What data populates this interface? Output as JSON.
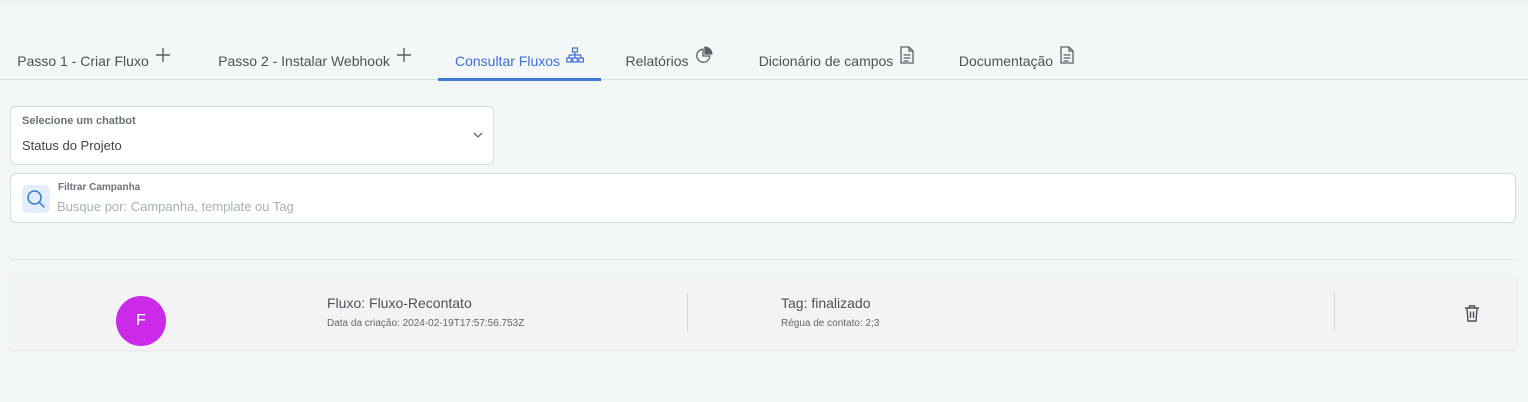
{
  "tabs": [
    {
      "label": "Passo 1 - Criar Fluxo",
      "icon": "plus-icon",
      "active": false
    },
    {
      "label": "Passo 2 - Instalar Webhook",
      "icon": "plus-icon",
      "active": false
    },
    {
      "label": "Consultar Fluxos",
      "icon": "sitemap-icon",
      "active": true
    },
    {
      "label": "Relatórios",
      "icon": "pie-chart-icon",
      "active": false
    },
    {
      "label": "Dicionário de campos",
      "icon": "document-icon",
      "active": false
    },
    {
      "label": "Documentação",
      "icon": "document-icon",
      "active": false
    }
  ],
  "chatbot_select": {
    "label": "Selecione um chatbot",
    "value": "Status do Projeto"
  },
  "filter": {
    "label": "Filtrar Campanha",
    "placeholder": "Busque por: Campanha, template ou Tag",
    "value": ""
  },
  "flows": [
    {
      "avatar_letter": "F",
      "name": "Fluxo: Fluxo-Recontato",
      "created": "Data da criação: 2024-02-19T17:57:56.753Z",
      "tag": "Tag: finalizado",
      "regua": "Régua de contato: 2;3"
    }
  ],
  "colors": {
    "accent": "#3d7bd9",
    "avatar": "#cb2be8",
    "background": "#f4f7f8"
  }
}
